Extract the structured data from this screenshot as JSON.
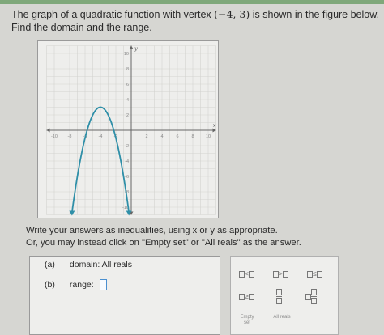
{
  "problem": {
    "line1_pre": "The graph of a quadratic function with vertex ",
    "vertex": "(−4, 3)",
    "line1_post": " is shown in the figure below.",
    "line2": "Find the domain and the range."
  },
  "chart_data": {
    "type": "line",
    "x_ticks": [
      "-10",
      "-8",
      "-6",
      "-4",
      "-2",
      "2",
      "4",
      "6",
      "8",
      "10"
    ],
    "y_ticks": [
      "10",
      "8",
      "6",
      "4",
      "2",
      "-2",
      "-4",
      "-6",
      "-8",
      "-10"
    ],
    "x_axis_label": "x",
    "y_axis_label": "y",
    "xlim": [
      -11,
      11
    ],
    "ylim": [
      -11,
      11
    ],
    "grid": true,
    "series": [
      {
        "function": "y = -(x + 4)^2 + 3",
        "vertex": [
          -4,
          3
        ],
        "x_start": -7.7,
        "x_end": -0.3,
        "arrows": "both ends, pointing down",
        "color": "#2f8fa8"
      }
    ]
  },
  "instructions": {
    "line1": "Write your answers as inequalities, using x or y as appropriate.",
    "line2": "Or, you may instead click on \"Empty set\" or \"All reals\" as the answer."
  },
  "answers": {
    "a_tag": "(a)",
    "a_text": "domain: All reals",
    "b_tag": "(b)",
    "b_text": "range:"
  },
  "keypad": {
    "less_than": "<",
    "greater_than": ">",
    "less_equal": "≤",
    "greater_equal": "≥",
    "empty_set": "Empty set",
    "all_reals": "All reals"
  }
}
